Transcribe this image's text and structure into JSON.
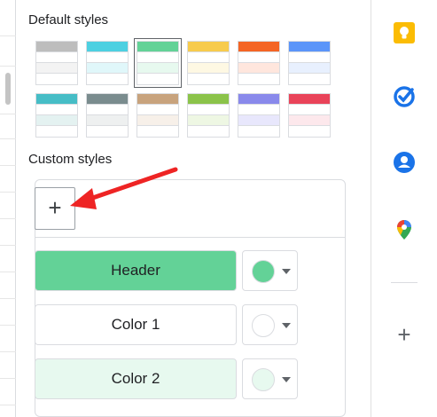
{
  "panel": {
    "default_styles_title": "Default styles",
    "custom_styles_title": "Custom styles",
    "add_button_label": "+",
    "custom_rows": [
      {
        "label": "Header",
        "fill": "#63d297",
        "dot": "#63d297"
      },
      {
        "label": "Color 1",
        "fill": "#ffffff",
        "dot": "#ffffff"
      },
      {
        "label": "Color 2",
        "fill": "#e7f9ef",
        "dot": "#e7f9ef"
      }
    ]
  },
  "default_swatches": [
    {
      "header": "#bdbdbd",
      "band": "#f3f3f3",
      "selected": false
    },
    {
      "header": "#4dd0e1",
      "band": "#e0f7fa",
      "selected": false
    },
    {
      "header": "#63d297",
      "band": "#e7f9ef",
      "selected": true
    },
    {
      "header": "#f7cb4d",
      "band": "#fef8e3",
      "selected": false
    },
    {
      "header": "#f46524",
      "band": "#ffe6dd",
      "selected": false
    },
    {
      "header": "#5b95f9",
      "band": "#e8f0fe",
      "selected": false
    },
    {
      "header": "#46bdc6",
      "band": "#e4f2f1",
      "selected": false
    },
    {
      "header": "#7a8c8e",
      "band": "#eef0f0",
      "selected": false
    },
    {
      "header": "#c8a37d",
      "band": "#f7f0e9",
      "selected": false
    },
    {
      "header": "#8bc34a",
      "band": "#eef7e3",
      "selected": false
    },
    {
      "header": "#8989eb",
      "band": "#e8e7fc",
      "selected": false
    },
    {
      "header": "#e94359",
      "band": "#fde8ec",
      "selected": false
    }
  ],
  "colors": {
    "annotation_arrow": "#ee2424"
  },
  "rail": {
    "icons": [
      "keep-icon",
      "tasks-icon",
      "contacts-icon",
      "maps-icon"
    ],
    "add_label": "+"
  }
}
